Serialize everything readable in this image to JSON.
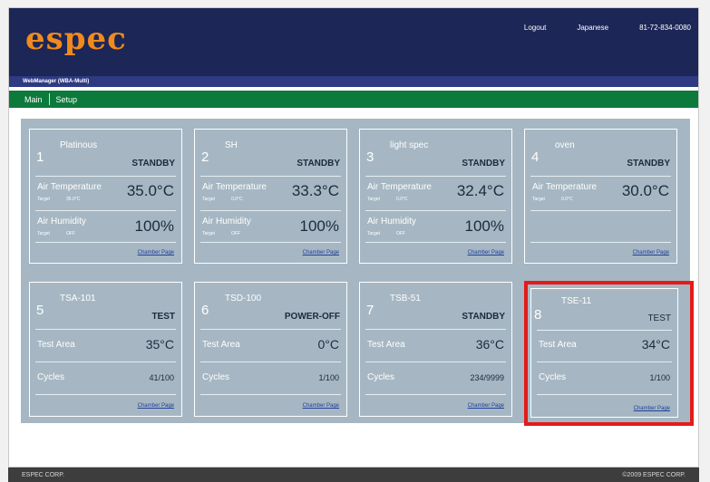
{
  "header": {
    "logo": "espec",
    "links": [
      "Logout",
      "Japanese",
      "81-72-834-0080"
    ]
  },
  "subbar": {
    "title": "WebManager (WBA-Multi)"
  },
  "nav": {
    "items": [
      "Main",
      "Setup"
    ]
  },
  "chambers": [
    {
      "number": "1",
      "name": "Platinous",
      "status": "STANDBY",
      "row1_label": "Air Temperature",
      "row1_sub_label": "Target",
      "row1_sub_value": "35.0°C",
      "row1_value": "35.0°C",
      "row2_label": "Air Humidity",
      "row2_sub_label": "Target",
      "row2_sub_value": "OFF",
      "row2_value": "100%",
      "link": "Chamber Page"
    },
    {
      "number": "2",
      "name": "SH",
      "status": "STANDBY",
      "row1_label": "Air Temperature",
      "row1_sub_label": "Target",
      "row1_sub_value": "0.0°C",
      "row1_value": "33.3°C",
      "row2_label": "Air Humidity",
      "row2_sub_label": "Target",
      "row2_sub_value": "OFF",
      "row2_value": "100%",
      "link": "Chamber Page"
    },
    {
      "number": "3",
      "name": "light spec",
      "status": "STANDBY",
      "row1_label": "Air Temperature",
      "row1_sub_label": "Target",
      "row1_sub_value": "0.0°C",
      "row1_value": "32.4°C",
      "row2_label": "Air Humidity",
      "row2_sub_label": "Target",
      "row2_sub_value": "OFF",
      "row2_value": "100%",
      "link": "Chamber Page"
    },
    {
      "number": "4",
      "name": "oven",
      "status": "STANDBY",
      "row1_label": "Air Temperature",
      "row1_sub_label": "Target",
      "row1_sub_value": "0.0°C",
      "row1_value": "30.0°C",
      "link": "Chamber Page"
    },
    {
      "number": "5",
      "name": "TSA-101",
      "status": "TEST",
      "row1_label": "Test Area",
      "row1_value": "35°C",
      "row2_label": "Cycles",
      "row2_value": "41/100",
      "link": "Chamber Page"
    },
    {
      "number": "6",
      "name": "TSD-100",
      "status": "POWER-OFF",
      "row1_label": "Test Area",
      "row1_value": "0°C",
      "row2_label": "Cycles",
      "row2_value": "1/100",
      "link": "Chamber Page"
    },
    {
      "number": "7",
      "name": "TSB-51",
      "status": "STANDBY",
      "row1_label": "Test Area",
      "row1_value": "36°C",
      "row2_label": "Cycles",
      "row2_value": "234/9999",
      "link": "Chamber Page"
    },
    {
      "number": "8",
      "name": "TSE-11",
      "status": "TEST",
      "row1_label": "Test Area",
      "row1_value": "34°C",
      "row2_label": "Cycles",
      "row2_value": "1/100",
      "link": "Chamber Page"
    }
  ],
  "footer": {
    "left": "ESPEC CORP.",
    "right": "©2009 ESPEC CORP."
  },
  "colors": {
    "header": "#1c2657",
    "nav": "#0c7a3a",
    "panel": "#a6b7c3",
    "logo": "#f08a1c",
    "highlight": "#e31b1b"
  }
}
